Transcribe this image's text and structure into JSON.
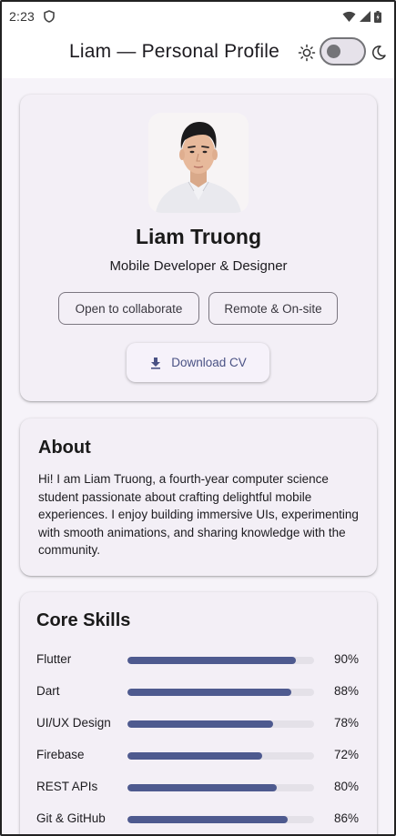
{
  "status_bar": {
    "time": "2:23"
  },
  "app_bar": {
    "title": "Liam — Personal Profile",
    "theme_toggle_on": false
  },
  "profile": {
    "name": "Liam Truong",
    "role": "Mobile Developer & Designer",
    "chips": [
      "Open to collaborate",
      "Remote & On-site"
    ],
    "download_label": "Download CV"
  },
  "about": {
    "heading": "About",
    "text": "Hi! I am Liam Truong, a fourth-year computer science student passionate about crafting delightful mobile experiences. I enjoy building immersive UIs, experimenting with smooth animations, and sharing knowledge with the community."
  },
  "skills": {
    "heading": "Core Skills",
    "items": [
      {
        "name": "Flutter",
        "percent": "90%",
        "level": 0.9
      },
      {
        "name": "Dart",
        "percent": "88%",
        "level": 0.88
      },
      {
        "name": "UI/UX Design",
        "percent": "78%",
        "level": 0.78
      },
      {
        "name": "Firebase",
        "percent": "72%",
        "level": 0.72
      },
      {
        "name": "REST APIs",
        "percent": "80%",
        "level": 0.8
      },
      {
        "name": "Git & GitHub",
        "percent": "86%",
        "level": 0.86
      }
    ]
  },
  "colors": {
    "accent": "#4e5a8f",
    "card_background": "#f3eff6",
    "page_background": "#f6f3f9"
  }
}
